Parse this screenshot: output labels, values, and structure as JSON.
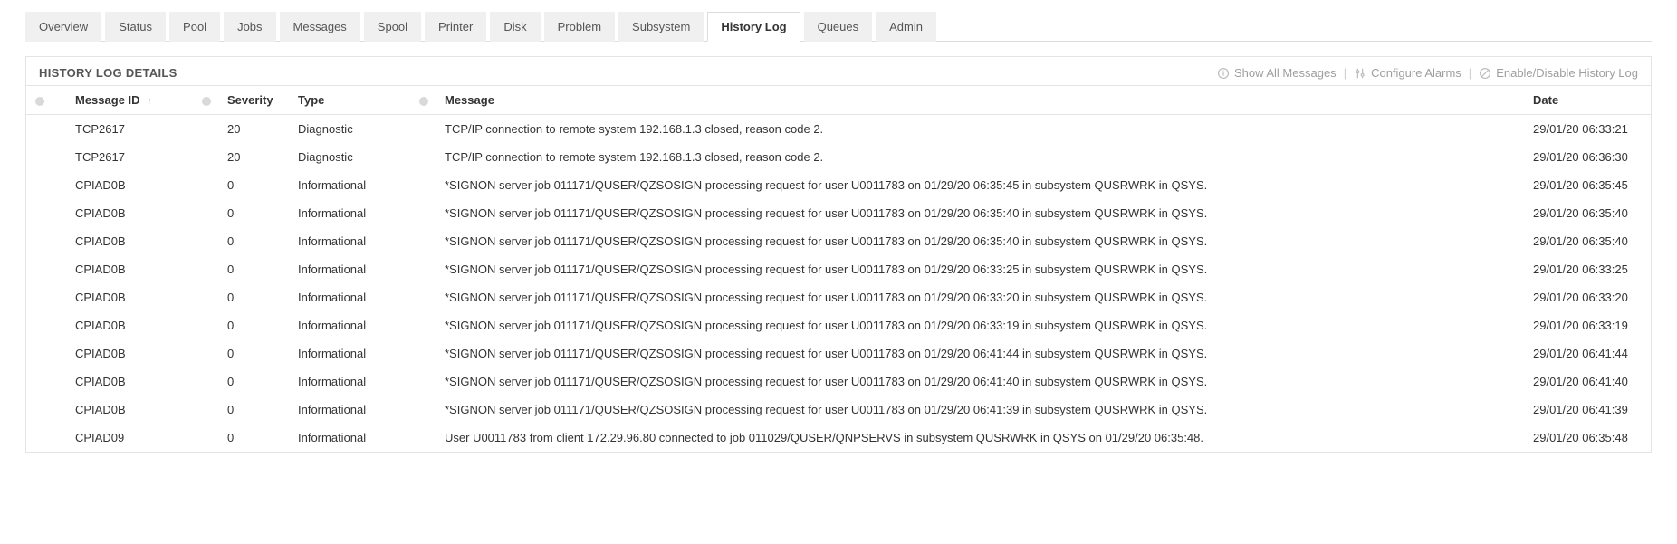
{
  "tabs": [
    {
      "label": "Overview"
    },
    {
      "label": "Status"
    },
    {
      "label": "Pool"
    },
    {
      "label": "Jobs"
    },
    {
      "label": "Messages"
    },
    {
      "label": "Spool"
    },
    {
      "label": "Printer"
    },
    {
      "label": "Disk"
    },
    {
      "label": "Problem"
    },
    {
      "label": "Subsystem"
    },
    {
      "label": "History Log"
    },
    {
      "label": "Queues"
    },
    {
      "label": "Admin"
    }
  ],
  "active_tab_index": 10,
  "panel": {
    "title": "HISTORY LOG DETAILS",
    "actions": {
      "show_all": "Show All Messages",
      "configure": "Configure Alarms",
      "enable_disable": "Enable/Disable History Log"
    }
  },
  "table": {
    "headers": {
      "message_id": "Message ID",
      "sort_indicator": "↑",
      "severity": "Severity",
      "type": "Type",
      "message": "Message",
      "date": "Date"
    },
    "rows": [
      {
        "id": "TCP2617",
        "severity": "20",
        "type": "Diagnostic",
        "message": "TCP/IP connection to remote system 192.168.1.3 closed, reason code 2.",
        "date": "29/01/20 06:33:21"
      },
      {
        "id": "TCP2617",
        "severity": "20",
        "type": "Diagnostic",
        "message": "TCP/IP connection to remote system 192.168.1.3 closed, reason code 2.",
        "date": "29/01/20 06:36:30"
      },
      {
        "id": "CPIAD0B",
        "severity": "0",
        "type": "Informational",
        "message": "*SIGNON server job 011171/QUSER/QZSOSIGN processing request for user U0011783 on 01/29/20 06:35:45 in subsystem QUSRWRK in QSYS.",
        "date": "29/01/20 06:35:45"
      },
      {
        "id": "CPIAD0B",
        "severity": "0",
        "type": "Informational",
        "message": "*SIGNON server job 011171/QUSER/QZSOSIGN processing request for user U0011783 on 01/29/20 06:35:40 in subsystem QUSRWRK in QSYS.",
        "date": "29/01/20 06:35:40"
      },
      {
        "id": "CPIAD0B",
        "severity": "0",
        "type": "Informational",
        "message": "*SIGNON server job 011171/QUSER/QZSOSIGN processing request for user U0011783 on 01/29/20 06:35:40 in subsystem QUSRWRK in QSYS.",
        "date": "29/01/20 06:35:40"
      },
      {
        "id": "CPIAD0B",
        "severity": "0",
        "type": "Informational",
        "message": "*SIGNON server job 011171/QUSER/QZSOSIGN processing request for user U0011783 on 01/29/20 06:33:25 in subsystem QUSRWRK in QSYS.",
        "date": "29/01/20 06:33:25"
      },
      {
        "id": "CPIAD0B",
        "severity": "0",
        "type": "Informational",
        "message": "*SIGNON server job 011171/QUSER/QZSOSIGN processing request for user U0011783 on 01/29/20 06:33:20 in subsystem QUSRWRK in QSYS.",
        "date": "29/01/20 06:33:20"
      },
      {
        "id": "CPIAD0B",
        "severity": "0",
        "type": "Informational",
        "message": "*SIGNON server job 011171/QUSER/QZSOSIGN processing request for user U0011783 on 01/29/20 06:33:19 in subsystem QUSRWRK in QSYS.",
        "date": "29/01/20 06:33:19"
      },
      {
        "id": "CPIAD0B",
        "severity": "0",
        "type": "Informational",
        "message": "*SIGNON server job 011171/QUSER/QZSOSIGN processing request for user U0011783 on 01/29/20 06:41:44 in subsystem QUSRWRK in QSYS.",
        "date": "29/01/20 06:41:44"
      },
      {
        "id": "CPIAD0B",
        "severity": "0",
        "type": "Informational",
        "message": "*SIGNON server job 011171/QUSER/QZSOSIGN processing request for user U0011783 on 01/29/20 06:41:40 in subsystem QUSRWRK in QSYS.",
        "date": "29/01/20 06:41:40"
      },
      {
        "id": "CPIAD0B",
        "severity": "0",
        "type": "Informational",
        "message": "*SIGNON server job 011171/QUSER/QZSOSIGN processing request for user U0011783 on 01/29/20 06:41:39 in subsystem QUSRWRK in QSYS.",
        "date": "29/01/20 06:41:39"
      },
      {
        "id": "CPIAD09",
        "severity": "0",
        "type": "Informational",
        "message": "User U0011783 from client 172.29.96.80 connected to job 011029/QUSER/QNPSERVS in subsystem QUSRWRK in QSYS on 01/29/20 06:35:48.",
        "date": "29/01/20 06:35:48"
      }
    ]
  }
}
